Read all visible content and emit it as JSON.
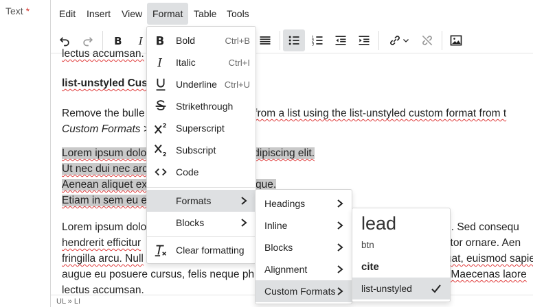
{
  "field": {
    "label": "Text",
    "required_mark": "*"
  },
  "menubar": {
    "items": [
      "Edit",
      "Insert",
      "View",
      "Format",
      "Table",
      "Tools"
    ]
  },
  "content": {
    "p0": "lectus accumsan.",
    "heading": "list-unstyled Cus",
    "p2a": "Remove the bulle",
    "p2b": "ng from a list using the list-unstyled custom format from t",
    "p3": "Custom Formats >",
    "li1a": "Lorem ipsum dolo",
    "li1b": "r adipiscing elit.",
    "li2": "Ut nec dui nec arc",
    "li3a": "Aenean aliquet ex",
    "li3b": "entesque.",
    "li4": "Etiam in sem eu e",
    "p5l1a": "Lorem ipsum dolo",
    "p5l1b": "am. Sed consequ",
    "p5l2a": "hendrerit efficitur",
    "p5l2b": "uctor ornare. Aen",
    "p5l3a": "fringilla arcu. Null",
    "p5l3b": "uat, euismod sapie",
    "p5l4a": "augue eu posuere cursus, felis neque ph",
    "p5l4b": "it. Maecenas laore",
    "p5l5": "lectus accumsan."
  },
  "status": {
    "path": "UL » LI"
  },
  "format_menu": {
    "items": [
      {
        "label": "Bold",
        "shortcut": "Ctrl+B",
        "icon": "bold-icon"
      },
      {
        "label": "Italic",
        "shortcut": "Ctrl+I",
        "icon": "italic-icon"
      },
      {
        "label": "Underline",
        "shortcut": "Ctrl+U",
        "icon": "underline-icon"
      },
      {
        "label": "Strikethrough",
        "shortcut": "",
        "icon": "strikethrough-icon"
      },
      {
        "label": "Superscript",
        "shortcut": "",
        "icon": "superscript-icon"
      },
      {
        "label": "Subscript",
        "shortcut": "",
        "icon": "subscript-icon"
      },
      {
        "label": "Code",
        "shortcut": "",
        "icon": "code-icon"
      }
    ],
    "formats": "Formats",
    "blocks": "Blocks",
    "clear": "Clear formatting"
  },
  "formats_menu": {
    "items": [
      "Headings",
      "Inline",
      "Blocks",
      "Alignment",
      "Custom Formats"
    ]
  },
  "custom_menu": {
    "items": [
      "lead",
      "btn",
      "cite",
      "list-unstyled"
    ],
    "checked": "list-unstyled"
  },
  "colors": {
    "active_bg": "#dee0e2",
    "selection": "#c9c9c9",
    "required": "#d4342c"
  }
}
